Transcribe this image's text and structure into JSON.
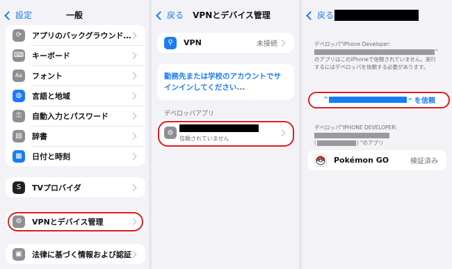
{
  "panel1": {
    "back_label": "設定",
    "title": "一般",
    "group1": [
      {
        "label": "アプリのバックグラウンド…",
        "icon": "app-refresh-icon"
      },
      {
        "label": "キーボード",
        "icon": "keyboard-icon"
      },
      {
        "label": "フォント",
        "icon": "font-icon"
      },
      {
        "label": "言語と地域",
        "icon": "globe-icon"
      },
      {
        "label": "自動入力とパスワード",
        "icon": "key-icon"
      },
      {
        "label": "辞書",
        "icon": "dictionary-icon"
      },
      {
        "label": "日付と時刻",
        "icon": "calendar-icon"
      }
    ],
    "tv_provider_label": "TVプロバイダ",
    "vpn_label": "VPNとデバイス管理",
    "legal_label": "法律に基づく情報および認証"
  },
  "panel2": {
    "back_label": "戻る",
    "title": "VPNとデバイス管理",
    "vpn_label": "VPN",
    "vpn_status": "未接続",
    "signin_text": "勤務先または学校のアカウントでサインインしてください...",
    "section_header": "デベロッパアプリ",
    "profile_status": "信頼されていません"
  },
  "panel3": {
    "back_label": "戻る",
    "desc1_prefix": "デベロッパ\"iPhone Developer:",
    "desc1_suffix": "\"",
    "desc1_body": "のアプリはこのiPhoneで信頼されていません。実行するにはデベロッパを信頼する必要があります。",
    "trust_prefix": "\"",
    "trust_suffix": "\" を信頼",
    "desc2_prefix": "デベロッパ\"IPHONE DEVELOPER:",
    "desc2_suffix": "\"のアプリ",
    "desc2_paren_open": "(",
    "desc2_paren_close": ")",
    "app_name": "Pokémon GO",
    "app_status": "検証済み"
  },
  "colors": {
    "accent": "#1a7cf5",
    "highlight": "#e21a1a"
  }
}
